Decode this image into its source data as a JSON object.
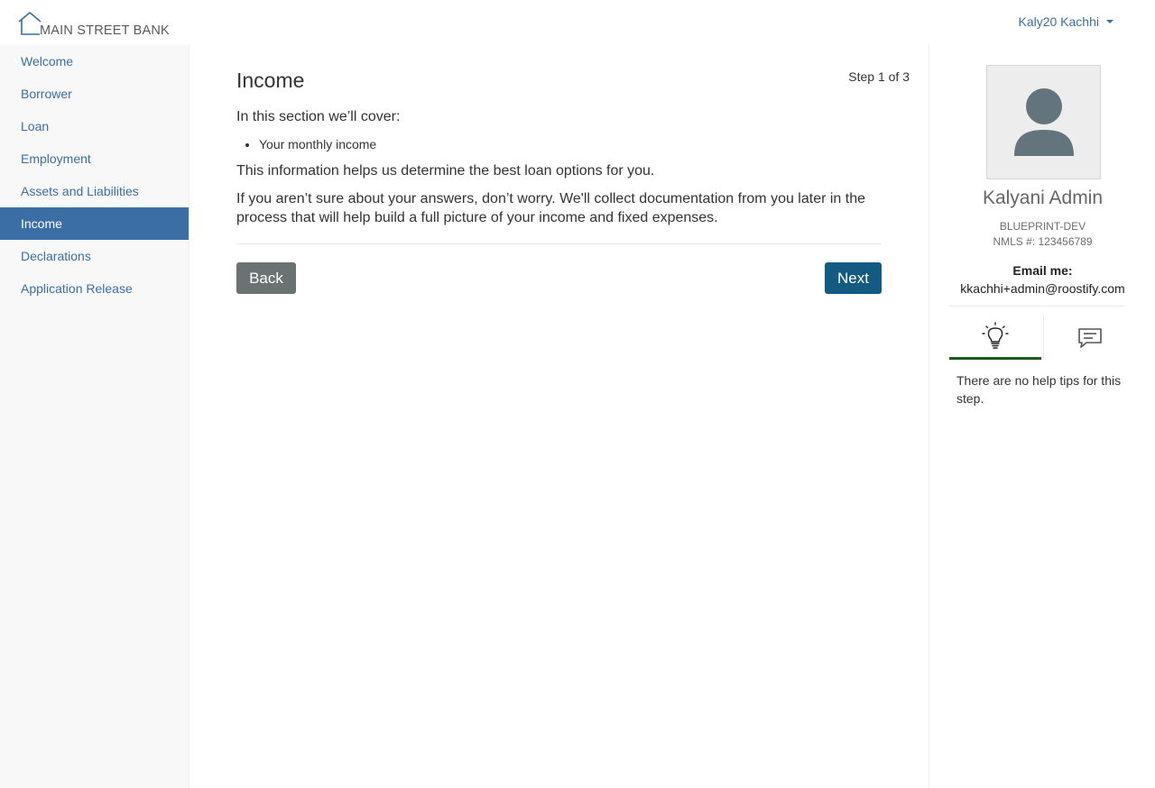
{
  "header": {
    "logo_text": "MAIN STREET BANK",
    "user_name": "Kaly20 Kachhi"
  },
  "sidebar": {
    "items": [
      {
        "label": "Welcome",
        "active": false
      },
      {
        "label": "Borrower",
        "active": false
      },
      {
        "label": "Loan",
        "active": false
      },
      {
        "label": "Employment",
        "active": false
      },
      {
        "label": "Assets and Liabilities",
        "active": false
      },
      {
        "label": "Income",
        "active": true
      },
      {
        "label": "Declarations",
        "active": false
      },
      {
        "label": "Application Release",
        "active": false
      }
    ]
  },
  "main": {
    "title": "Income",
    "step": "Step 1 of 3",
    "intro": "In this section we’ll cover:",
    "bullets": [
      "Your monthly income"
    ],
    "para1": "This information helps us determine the best loan options for you.",
    "para2": "If you aren’t sure about your answers, don’t worry. We'll collect documentation from you later in the process that will help build a full picture of your income and fixed expenses.",
    "back_label": "Back",
    "next_label": "Next"
  },
  "rep": {
    "name": "Kalyani Admin",
    "company": "BLUEPRINT-DEV",
    "nmls": "NMLS #: 123456789",
    "email_label": "Email me:",
    "email": "kkachhi+admin@roostify.com",
    "tabs": [
      {
        "icon": "lightbulb-icon",
        "active": true
      },
      {
        "icon": "chat-icon",
        "active": false
      }
    ],
    "tip_text": "There are no help tips for this step."
  },
  "colors": {
    "accent": "#3b6ea5",
    "next_button": "#135b82",
    "back_button": "#6b7272",
    "active_tab_underline": "#1a5c1a"
  }
}
